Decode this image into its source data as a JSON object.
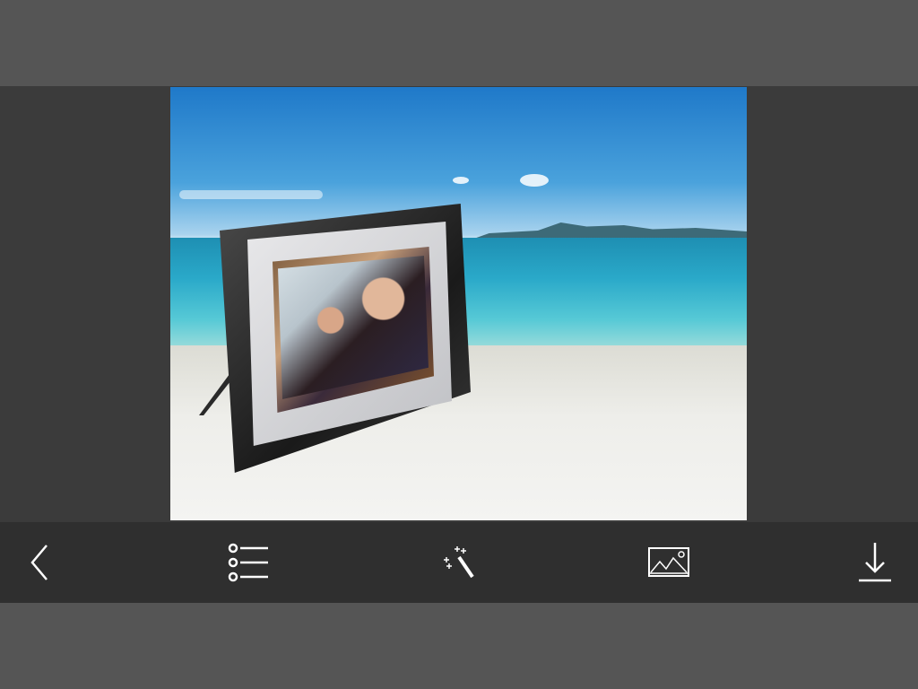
{
  "colors": {
    "outer_bg": "#555555",
    "stage_bg": "#3b3b3b",
    "toolbar_bg": "#2f2f2f",
    "icon": "#ffffff"
  },
  "toolbar": {
    "items": [
      {
        "icon": "back-chevron-icon"
      },
      {
        "icon": "list-icon"
      },
      {
        "icon": "magic-wand-icon"
      },
      {
        "icon": "image-icon"
      },
      {
        "icon": "download-icon"
      }
    ]
  }
}
